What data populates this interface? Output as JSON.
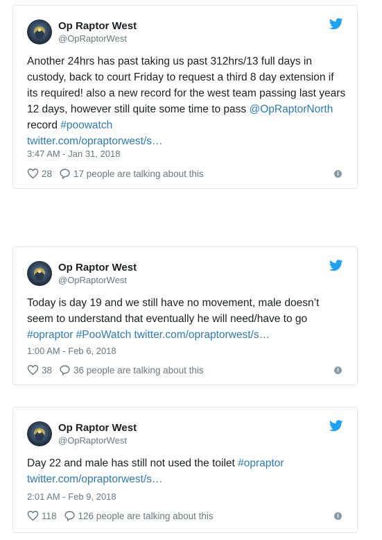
{
  "colors": {
    "link": "#2b7bb9",
    "muted": "#697882",
    "bird": "#1da1f2",
    "border": "#e1e8ed"
  },
  "tweets": [
    {
      "display_name": "Op Raptor West",
      "handle": "@OpRaptorWest",
      "text_main": "Another 24hrs has past taking us past 312hrs/13 full days in custody, back to court Friday to request a third 8 day extension if its required! also a new record for the west team passing last years 12 days, however still quite some time to pass ",
      "mention": "@OpRaptorNorth",
      "text_mid": " record ",
      "hashtag": "#poowatch",
      "link": "twitter.com/opraptorwest/s…",
      "timestamp": "3:47 AM - Jan 31, 2018",
      "likes": "28",
      "talking": "17 people are talking about this",
      "icons": [
        "bird-icon",
        "heart-icon",
        "comment-icon",
        "info-icon"
      ]
    },
    {
      "display_name": "Op Raptor West",
      "handle": "@OpRaptorWest",
      "text_main": "Today is day 19 and we still have no movement, male doesn’t seem to understand that eventually he will need/have to go ",
      "hashtag1": "#opraptor",
      "hashtag2": "#PooWatch",
      "link": "twitter.com/opraptorwest/s…",
      "timestamp": "1:00 AM - Feb 6, 2018",
      "likes": "38",
      "talking": "36 people are talking about this"
    },
    {
      "display_name": "Op Raptor West",
      "handle": "@OpRaptorWest",
      "text_main": "Day 22 and male has still not used the toilet ",
      "hashtag": "#opraptor",
      "link": "twitter.com/opraptorwest/s…",
      "timestamp": "2:01 AM - Feb 9, 2018",
      "likes": "118",
      "talking": "126 people are talking about this"
    }
  ]
}
